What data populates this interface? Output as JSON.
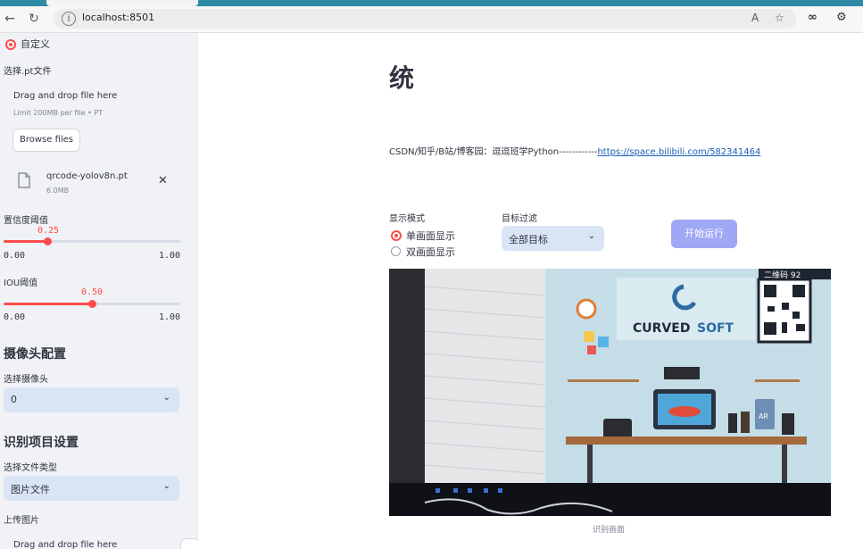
{
  "browser": {
    "url": "localhost:8501",
    "read_aloud_glyph": "A",
    "extensions_glyph": "∞"
  },
  "sidebar": {
    "radio_custom_label": "自定义",
    "model_file_label": "选择.pt文件",
    "uploader": {
      "drop_text": "Drag and drop file here",
      "limit_text": "Limit 200MB per file • PT",
      "browse_label": "Browse files"
    },
    "uploaded_file": {
      "name": "qrcode-yolov8n.pt",
      "size": "6.0MB"
    },
    "confidence": {
      "label": "置信度阈值",
      "value": 0.25,
      "value_text": "0.25",
      "min": "0.00",
      "max": "1.00"
    },
    "iou": {
      "label": "IOU阈值",
      "value": 0.5,
      "value_text": "0.50",
      "min": "0.00",
      "max": "1.00"
    },
    "camera_section": "摄像头配置",
    "camera_label": "选择摄像头",
    "camera_value": "0",
    "project_section": "识别项目设置",
    "filetype_label": "选择文件类型",
    "filetype_value": "图片文件",
    "upload_image_label": "上传图片",
    "upload_image_drop": "Drag and drop file here"
  },
  "main": {
    "title": "统",
    "credit_prefix": "CSDN/知乎/B站/博客园：逗逗班学Python------------",
    "credit_link": "https://space.bilibili.com/582341464",
    "display_mode_label": "显示模式",
    "display_options": [
      "单画面显示",
      "双画面显示"
    ],
    "target_filter_label": "目标过滤",
    "target_filter_value": "全部目标",
    "start_button": "开始运行",
    "image_caption": "识别画面",
    "scene": {
      "logo_top": "CURVED",
      "logo_bottom": "SOFT",
      "qr_banner": "二维码 92",
      "ar_label": "AR"
    }
  },
  "colors": {
    "accent": "#ff4b4b",
    "sidebar_bg": "#f0f2f6",
    "select_bg": "#d9e5f5",
    "start_button": "#9fa8f5"
  }
}
